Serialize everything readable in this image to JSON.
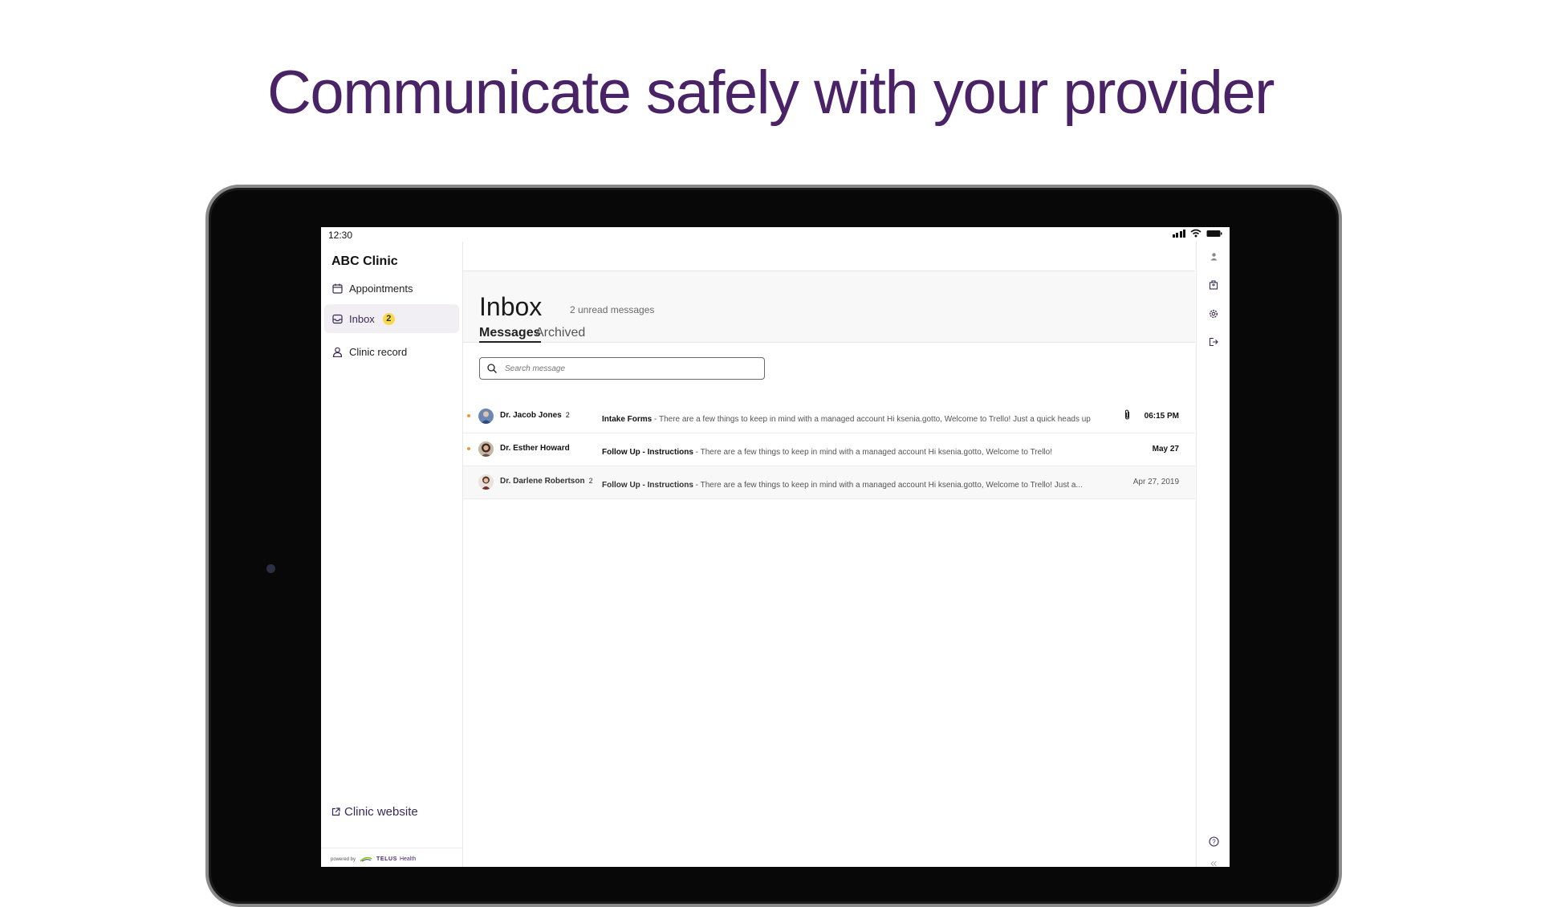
{
  "headline": "Communicate safely with your provider",
  "status_bar": {
    "time": "12:30"
  },
  "sidebar": {
    "clinic_name": "ABC Clinic",
    "items": [
      {
        "label": "Appointments",
        "icon": "calendar-icon"
      },
      {
        "label": "Inbox",
        "icon": "inbox-icon",
        "badge": "2"
      },
      {
        "label": "Clinic record",
        "icon": "person-icon"
      }
    ],
    "clinic_website": "Clinic website",
    "powered_by": "powered by",
    "brand": "TELUS",
    "brand_sub": "Health"
  },
  "inbox": {
    "title": "Inbox",
    "unread": "2 unread messages",
    "tabs": [
      "Messages",
      "Archived"
    ],
    "search_placeholder": "Search message"
  },
  "messages": [
    {
      "sender": "Dr. Jacob Jones",
      "count": "2",
      "subject": "Intake Forms",
      "preview": " - There are a few things to keep in mind with a managed account Hi ksenia.gotto, Welcome to Trello! Just a quick heads up",
      "date": "06:15 PM",
      "unread": true,
      "attachment": true
    },
    {
      "sender": "Dr. Esther Howard",
      "count": "",
      "subject": "Follow Up - Instructions",
      "preview": " - There are a few things to keep in mind with a managed account Hi ksenia.gotto, Welcome to Trello!",
      "date": "May 27",
      "unread": true,
      "attachment": false
    },
    {
      "sender": "Dr. Darlene Robertson",
      "count": "2",
      "subject": "Follow Up - Instructions",
      "preview": " - There are a few things to keep in mind with a managed account Hi ksenia.gotto, Welcome to Trello! Just a...",
      "date": "Apr 27, 2019",
      "unread": false,
      "attachment": false
    }
  ],
  "right_icons": [
    "user-icon",
    "building-icon",
    "gear-icon",
    "logout-icon",
    "help-icon",
    "collapse-icon"
  ],
  "colors": {
    "headline": "#4a2367",
    "accent": "#3a2a55",
    "unread_dot": "#e99a3a",
    "badge": "#f7d94c"
  }
}
